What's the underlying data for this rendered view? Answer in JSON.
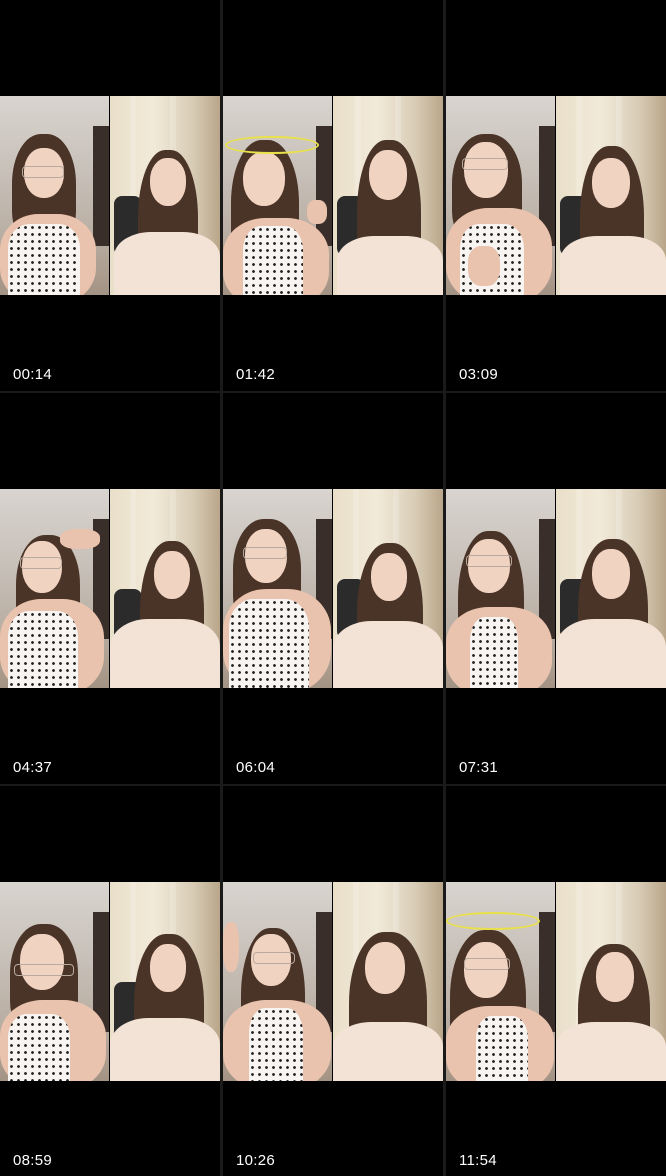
{
  "thumbnails": [
    {
      "time": "00:14"
    },
    {
      "time": "01:42"
    },
    {
      "time": "03:09"
    },
    {
      "time": "04:37"
    },
    {
      "time": "06:04"
    },
    {
      "time": "07:31"
    },
    {
      "time": "08:59"
    },
    {
      "time": "10:26"
    },
    {
      "time": "11:54"
    }
  ]
}
